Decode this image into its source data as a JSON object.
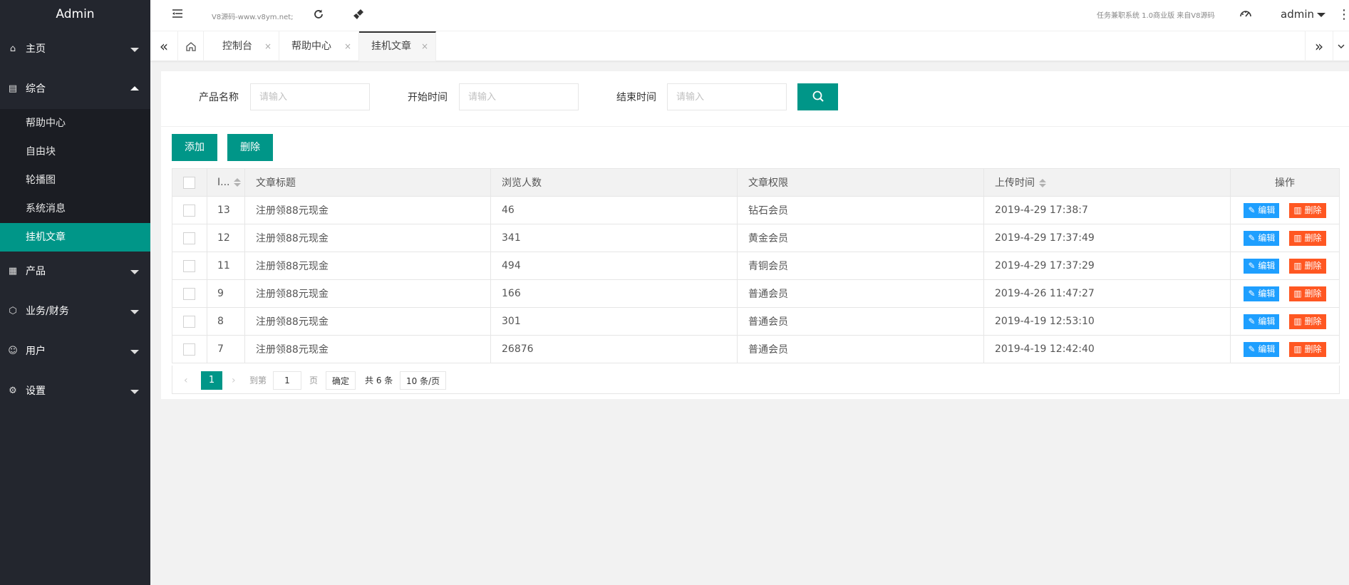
{
  "app": {
    "title": "Admin"
  },
  "sidebar": {
    "items": [
      {
        "label": "主页",
        "icon": "home-icon"
      },
      {
        "label": "综合",
        "icon": "grid-icon",
        "expanded": true
      },
      {
        "label": "产品",
        "icon": "apps-icon"
      },
      {
        "label": "业务/财务",
        "icon": "box-icon"
      },
      {
        "label": "用户",
        "icon": "user-icon"
      },
      {
        "label": "设置",
        "icon": "gear-icon"
      }
    ],
    "sub_items": [
      "帮助中心",
      "自由块",
      "轮播图",
      "系统消息",
      "挂机文章"
    ],
    "active_sub": "挂机文章"
  },
  "header": {
    "site": "V8源码-www.v8ym.net;",
    "system": "任务兼职系统 1.0商业版 来自V8源码",
    "user": "admin"
  },
  "tabs": {
    "items": [
      {
        "label": "控制台",
        "active": false
      },
      {
        "label": "帮助中心",
        "active": false
      },
      {
        "label": "挂机文章",
        "active": true
      }
    ],
    "close": "×"
  },
  "search": {
    "fields": [
      {
        "label": "产品名称",
        "placeholder": "请输入"
      },
      {
        "label": "开始时间",
        "placeholder": "请输入"
      },
      {
        "label": "结束时间",
        "placeholder": "请输入"
      }
    ]
  },
  "toolbar": {
    "add": "添加",
    "delete": "删除"
  },
  "table": {
    "headers": [
      "I...",
      "文章标题",
      "浏览人数",
      "文章权限",
      "上传时间",
      "操作"
    ],
    "rows": [
      {
        "id": "13",
        "title": "注册领88元现金",
        "views": "46",
        "perm": "钻石会员",
        "time": "2019-4-29 17:38:7"
      },
      {
        "id": "12",
        "title": "注册领88元现金",
        "views": "341",
        "perm": "黄金会员",
        "time": "2019-4-29 17:37:49"
      },
      {
        "id": "11",
        "title": "注册领88元现金",
        "views": "494",
        "perm": "青铜会员",
        "time": "2019-4-29 17:37:29"
      },
      {
        "id": "9",
        "title": "注册领88元现金",
        "views": "166",
        "perm": "普通会员",
        "time": "2019-4-26 11:47:27"
      },
      {
        "id": "8",
        "title": "注册领88元现金",
        "views": "301",
        "perm": "普通会员",
        "time": "2019-4-19 12:53:10"
      },
      {
        "id": "7",
        "title": "注册领88元现金",
        "views": "26876",
        "perm": "普通会员",
        "time": "2019-4-19 12:42:40"
      }
    ],
    "edit_label": "编辑",
    "delete_label": "删除"
  },
  "pager": {
    "current": "1",
    "goto_label": "到第",
    "goto_value": "1",
    "page_label": "页",
    "confirm": "确定",
    "total": "共 6 条",
    "per_page": "10 条/页"
  },
  "colors": {
    "accent": "#009688",
    "sidebar": "#23262e",
    "edit": "#1e9fff",
    "danger": "#ff5722"
  }
}
